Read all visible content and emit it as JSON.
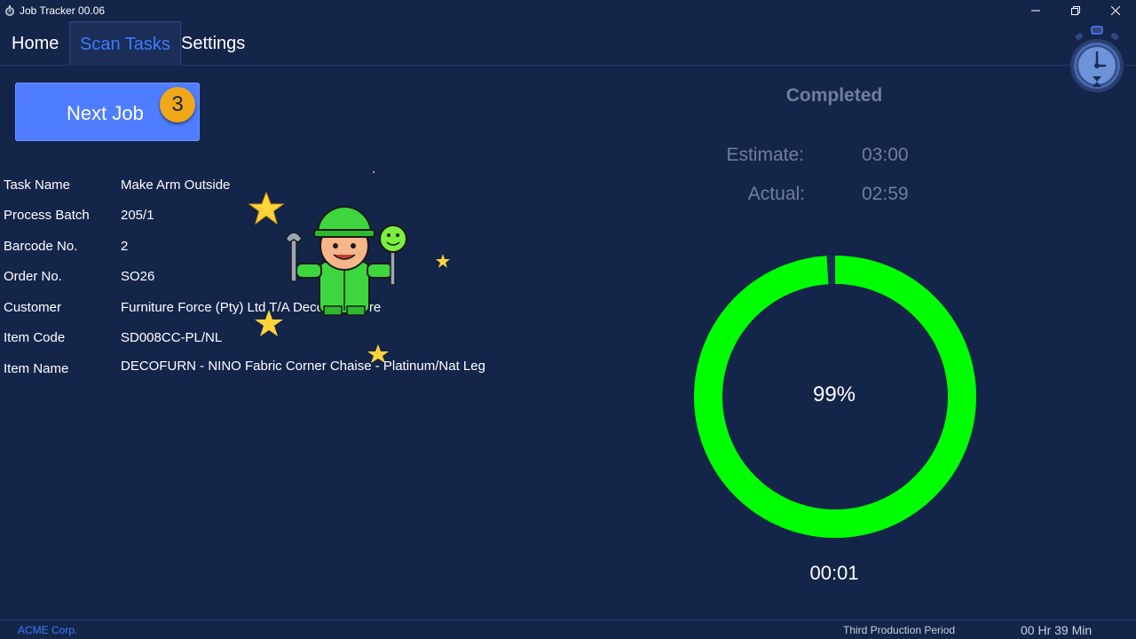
{
  "window": {
    "title": "Job Tracker 00.06",
    "minimize_icon": "minimize-icon",
    "restore_icon": "restore-icon",
    "close_icon": "close-icon"
  },
  "tabs": [
    {
      "label": "Home"
    },
    {
      "label": "Scan Tasks",
      "active": true
    },
    {
      "label": "Settings"
    }
  ],
  "next_job": {
    "label": "Next Job",
    "count": "3"
  },
  "details": [
    {
      "label": "Task Name",
      "value": "Make Arm Outside"
    },
    {
      "label": "Process Batch",
      "value": "205/1"
    },
    {
      "label": "Barcode No.",
      "value": "2"
    },
    {
      "label": "Order No.",
      "value": "SO26"
    },
    {
      "label": "Customer",
      "value": "Furniture Force (Pty) Ltd T/A Deco Furniture"
    },
    {
      "label": "Item Code",
      "value": "SD008CC-PL/NL"
    },
    {
      "label": "Item Name",
      "value": "DECOFURN - NINO Fabric Corner Chaise - Platinum/Nat Leg"
    }
  ],
  "status_panel": {
    "heading": "Completed",
    "estimate_label": "Estimate:",
    "estimate_value": "03:00",
    "actual_label": "Actual:",
    "actual_value": "02:59",
    "progress_percent_text": "99%",
    "progress_fraction": 0.99,
    "elapsed": "00:01"
  },
  "statusbar": {
    "company": "ACME Corp.",
    "period": "Third Production Period",
    "time": "00 Hr 39 Min"
  },
  "colors": {
    "background": "#14254a",
    "accent": "#3e7bff",
    "button": "#4f7dff",
    "badge": "#f0a818",
    "gauge": "#00ff00",
    "muted_text": "#6e7f9f"
  }
}
